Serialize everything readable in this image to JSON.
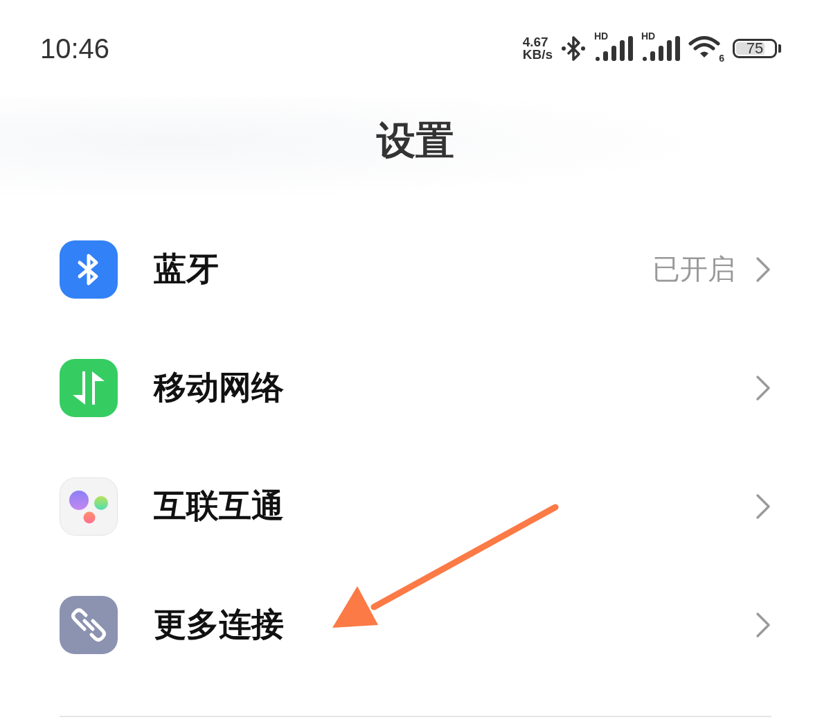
{
  "status_bar": {
    "time": "10:46",
    "net_speed": {
      "value": "4.67",
      "unit": "KB/s"
    },
    "signals": [
      {
        "label": "HD"
      },
      {
        "label": "HD"
      }
    ],
    "wifi": {
      "label": "6"
    },
    "battery": {
      "label": "75",
      "level": 0.75
    }
  },
  "header": {
    "title": "设置"
  },
  "items": [
    {
      "kind": "bluetooth",
      "label": "蓝牙",
      "value": "已开启"
    },
    {
      "kind": "mobile-data",
      "label": "移动网络"
    },
    {
      "kind": "interconnect",
      "label": "互联互通"
    },
    {
      "kind": "link",
      "label": "更多连接"
    }
  ],
  "annotation": {
    "kind": "arrow"
  }
}
